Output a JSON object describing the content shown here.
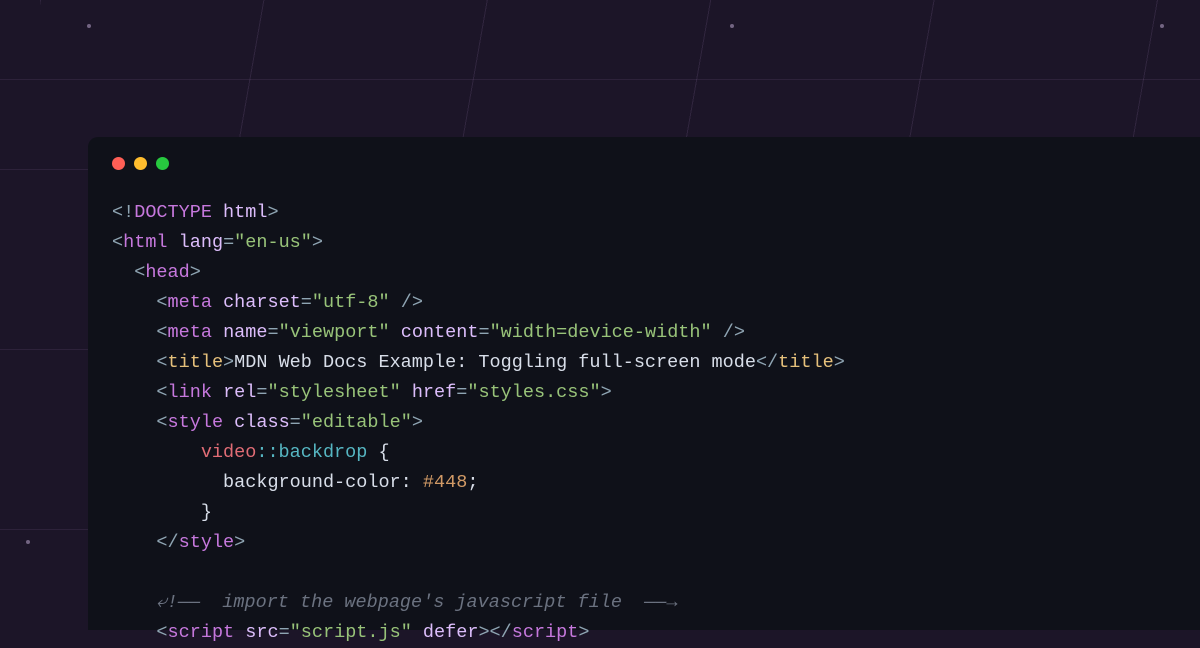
{
  "code": {
    "doctype": {
      "bang": "<!",
      "word": "DOCTYPE",
      "html": "html",
      "close": ">"
    },
    "html_open": {
      "tag": "html",
      "attr": "lang",
      "val": "\"en-us\""
    },
    "head_open": "head",
    "meta1": {
      "tag": "meta",
      "attr": "charset",
      "val": "\"utf-8\""
    },
    "meta2": {
      "tag": "meta",
      "a1": "name",
      "v1": "\"viewport\"",
      "a2": "content",
      "v2": "\"width=device-width\""
    },
    "title": {
      "tag": "title",
      "text": "MDN Web Docs Example: Toggling full-screen mode"
    },
    "link": {
      "tag": "link",
      "a1": "rel",
      "v1": "\"stylesheet\"",
      "a2": "href",
      "v2": "\"styles.css\""
    },
    "style_open": {
      "tag": "style",
      "attr": "class",
      "val": "\"editable\""
    },
    "css": {
      "selector": "video",
      "pseudo": "::backdrop",
      "prop": "background-color",
      "value": "#448"
    },
    "style_close": "style",
    "comment": "⤶!——  import the webpage's javascript file  ——→",
    "script": {
      "tag": "script",
      "a1": "src",
      "v1": "\"script.js\"",
      "a2": "defer"
    }
  }
}
